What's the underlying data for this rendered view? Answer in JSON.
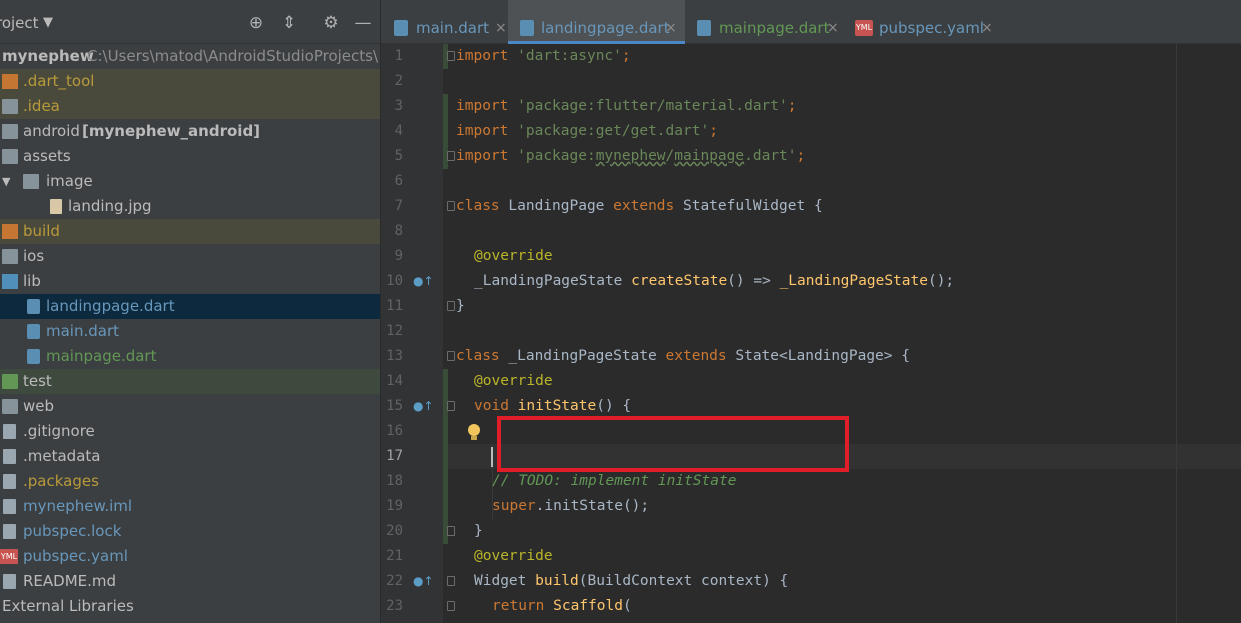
{
  "project": {
    "title": "roject",
    "root_name": "mynephew",
    "root_path": "C:\\Users\\matod\\AndroidStudioProjects\\",
    "items": [
      {
        "label": ".dart_tool"
      },
      {
        "label": ".idea"
      },
      {
        "label": "android",
        "suffix": "[mynephew_android]"
      },
      {
        "label": "assets"
      },
      {
        "label": "image"
      },
      {
        "label": "landing.jpg"
      },
      {
        "label": "build"
      },
      {
        "label": "ios"
      },
      {
        "label": "lib"
      },
      {
        "label": "landingpage.dart"
      },
      {
        "label": "main.dart"
      },
      {
        "label": "mainpage.dart"
      },
      {
        "label": "test"
      },
      {
        "label": "web"
      },
      {
        "label": ".gitignore"
      },
      {
        "label": ".metadata"
      },
      {
        "label": ".packages"
      },
      {
        "label": "mynephew.iml"
      },
      {
        "label": "pubspec.lock"
      },
      {
        "label": "pubspec.yaml"
      },
      {
        "label": "README.md"
      },
      {
        "label": "External Libraries"
      }
    ]
  },
  "tabs": [
    {
      "label": "main.dart",
      "color": "#6897bb"
    },
    {
      "label": "landingpage.dart",
      "color": "#6897bb"
    },
    {
      "label": "mainpage.dart",
      "color": "#629755"
    },
    {
      "label": "pubspec.yaml",
      "color": "#6897bb"
    }
  ],
  "close_glyph": "×",
  "yml_badge": "YML",
  "editor": {
    "line_numbers": [
      "1",
      "2",
      "3",
      "4",
      "5",
      "6",
      "7",
      "8",
      "9",
      "10",
      "11",
      "12",
      "13",
      "14",
      "15",
      "16",
      "17",
      "18",
      "19",
      "20",
      "21",
      "22",
      "23"
    ],
    "code": {
      "l1_kw": "import",
      "l1_str": "'dart:async'",
      "l1_end": ";",
      "l3_kw": "import",
      "l3_str": "'package:flutter/material.dart'",
      "l3_end": ";",
      "l4_kw": "import",
      "l4_str": "'package:get/get.dart'",
      "l4_end": ";",
      "l5_kw": "import",
      "l5_str_a": "'package:",
      "l5_str_b": "mynephew",
      "l5_str_c": "/",
      "l5_str_d": "mainpage",
      "l5_str_e": ".dart'",
      "l5_end": ";",
      "l7_kw": "class",
      "l7_name": " LandingPage ",
      "l7_kw2": "extends",
      "l7_rest": " StatefulWidget {",
      "l9_ann": "@override",
      "l10_type": "_LandingPageState ",
      "l10_fn": "createState",
      "l10_mid": "() => ",
      "l10_fn2": "_LandingPageState",
      "l10_end": "();",
      "l11": "}",
      "l13_kw": "class",
      "l13_name": " _LandingPageState ",
      "l13_kw2": "extends",
      "l13_rest": " State<LandingPage> {",
      "l14_ann": "@override",
      "l15_kw": "void",
      "l15_fn": " initState",
      "l15_rest": "() {",
      "l18_cmt": "// TODO: implement initState",
      "l19_kw": "super",
      "l19_rest": ".initState();",
      "l20": "}",
      "l21_ann": "@override",
      "l22_type": "Widget ",
      "l22_fn": "build",
      "l22_rest": "(BuildContext context) {",
      "l23_kw": "return",
      "l23_fn": " Scaffold",
      "l23_rest": "("
    }
  }
}
